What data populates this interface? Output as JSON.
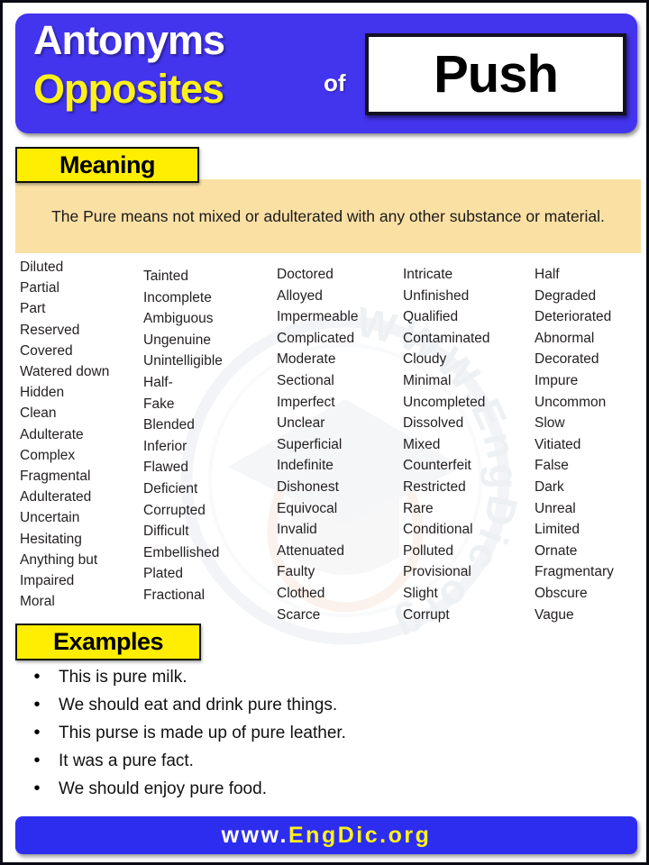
{
  "header": {
    "line1": "Antonyms",
    "line2": "Opposites",
    "of": "of",
    "word": "Push",
    "colors": {
      "band": "#4334ee",
      "line1": "#ffffff",
      "line2": "#fff21a",
      "word_box_bg": "#ffffff"
    }
  },
  "meaning": {
    "label": "Meaning",
    "text": "The Pure means not mixed or adulterated with any other substance or material.",
    "colors": {
      "label_bg": "#ffee00",
      "box_bg": "#fbe0a4"
    }
  },
  "columns": [
    {
      "words": [
        "Diluted",
        "Partial",
        "Part",
        "Reserved",
        "Covered",
        "Watered down",
        "Hidden",
        "Clean",
        "Adulterate",
        "Complex",
        "Fragmental",
        "Adulterated",
        "Uncertain",
        "Hesitating",
        "Anything but",
        "Impaired",
        "Moral"
      ]
    },
    {
      "words": [
        "Tainted",
        "Incomplete",
        "Ambiguous",
        "Ungenuine",
        "Unintelligible",
        "Half-",
        "Fake",
        "Blended",
        "Inferior",
        "Flawed",
        "Deficient",
        "Corrupted",
        "Difficult",
        "Embellished",
        "Plated",
        "Fractional"
      ]
    },
    {
      "words": [
        "Doctored",
        "Alloyed",
        "Impermeable",
        "Complicated",
        "Moderate",
        "Sectional",
        "Imperfect",
        "Unclear",
        "Superficial",
        "Indefinite",
        "Dishonest",
        "Equivocal",
        "Invalid",
        "Attenuated",
        "Faulty",
        "Clothed",
        "Scarce"
      ]
    },
    {
      "words": [
        "Intricate",
        "Unfinished",
        "Qualified",
        "Contaminated",
        "Cloudy",
        "Minimal",
        "Uncompleted",
        "Dissolved",
        "Mixed",
        "Counterfeit",
        "Restricted",
        "Rare",
        "Conditional",
        "Polluted",
        "Provisional",
        "Slight",
        "Corrupt"
      ]
    },
    {
      "words": [
        "Half",
        "Degraded",
        "Deteriorated",
        "Abnormal",
        "Decorated",
        "Impure",
        "Uncommon",
        "Slow",
        "Vitiated",
        "False",
        "Dark",
        "Unreal",
        "Limited",
        "Ornate",
        "Fragmentary",
        "Obscure",
        "Vague"
      ]
    }
  ],
  "examples": {
    "label": "Examples",
    "bullet": "•",
    "items": [
      "This is pure milk.",
      "We should eat and drink pure things.",
      "This purse is made up of pure leather.",
      "It was a pure fact.",
      "We should enjoy pure food."
    ]
  },
  "footer": {
    "part1": "www.",
    "part2": "EngDic",
    "part3": ".org",
    "colors": {
      "bg": "#2d2def",
      "white": "#ffffff",
      "yellow": "#fff21a"
    }
  },
  "watermark": {
    "text": "WWW.EngDic.org"
  }
}
